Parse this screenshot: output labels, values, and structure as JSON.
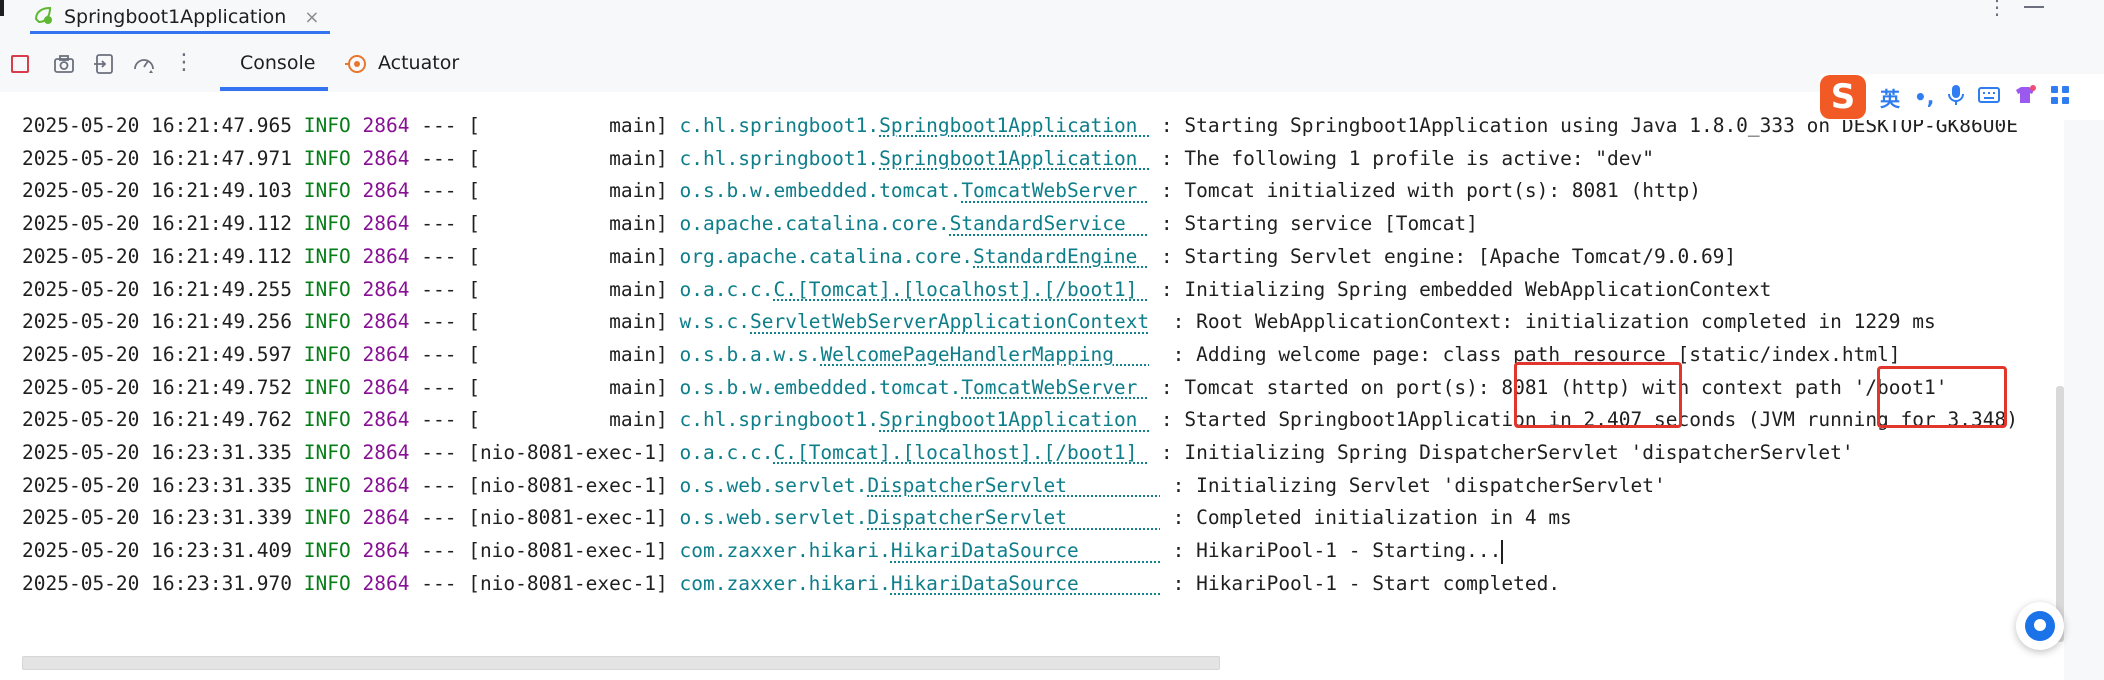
{
  "run_tab": {
    "title": "Springboot1Application",
    "close": "×"
  },
  "toolbar": {
    "tabs": [
      {
        "label": "Console",
        "active": true
      },
      {
        "label": "Actuator",
        "active": false
      }
    ],
    "more": "⋮"
  },
  "ime_toolbar": {
    "logo": "S",
    "lang": "英",
    "punct": "•,",
    "mic": "🎤",
    "keyboard": "⌨"
  },
  "colors": {
    "info": "#067d17",
    "pid": "#871094",
    "logger": "#0e7e8a",
    "accent": "#3574f0",
    "annotation": "#e0362b"
  },
  "console": {
    "lines": [
      {
        "ts": "2025-05-20 16:21:47.965",
        "level": "INFO",
        "pid": "2864",
        "sep": "---",
        "thread": "[           main]",
        "pkg": "c.hl.springboot1.",
        "cls": "Springboot1Application ",
        "msg": ": Starting Springboot1Application using Java 1.8.0_333 on DESKTOP-GK86U0E"
      },
      {
        "ts": "2025-05-20 16:21:47.971",
        "level": "INFO",
        "pid": "2864",
        "sep": "---",
        "thread": "[           main]",
        "pkg": "c.hl.springboot1.",
        "cls": "Springboot1Application ",
        "msg": ": The following 1 profile is active: \"dev\""
      },
      {
        "ts": "2025-05-20 16:21:49.103",
        "level": "INFO",
        "pid": "2864",
        "sep": "---",
        "thread": "[           main]",
        "pkg": "o.s.b.w.embedded.tomcat.",
        "cls": "TomcatWebServer ",
        "msg": ": Tomcat initialized with port(s): 8081 (http)"
      },
      {
        "ts": "2025-05-20 16:21:49.112",
        "level": "INFO",
        "pid": "2864",
        "sep": "---",
        "thread": "[           main]",
        "pkg": "o.apache.catalina.core.",
        "cls": "StandardService  ",
        "msg": ": Starting service [Tomcat]"
      },
      {
        "ts": "2025-05-20 16:21:49.112",
        "level": "INFO",
        "pid": "2864",
        "sep": "---",
        "thread": "[           main]",
        "pkg": "org.apache.catalina.core.",
        "cls": "StandardEngine ",
        "msg": ": Starting Servlet engine: [Apache Tomcat/9.0.69]"
      },
      {
        "ts": "2025-05-20 16:21:49.255",
        "level": "INFO",
        "pid": "2864",
        "sep": "---",
        "thread": "[           main]",
        "pkg": "o.a.c.c.",
        "cls": "C.[Tomcat].[localhost].[/boot1] ",
        "msg": ": Initializing Spring embedded WebApplicationContext"
      },
      {
        "ts": "2025-05-20 16:21:49.256",
        "level": "INFO",
        "pid": "2864",
        "sep": "---",
        "thread": "[           main]",
        "pkg": "w.s.c.",
        "cls": "ServletWebServerApplicationContext",
        "msg": " : Root WebApplicationContext: initialization completed in 1229 ms"
      },
      {
        "ts": "2025-05-20 16:21:49.597",
        "level": "INFO",
        "pid": "2864",
        "sep": "---",
        "thread": "[           main]",
        "pkg": "o.s.b.a.w.s.",
        "cls": "WelcomePageHandlerMapping   ",
        "msg": " : Adding welcome page: class path resource [static/index.html]"
      },
      {
        "ts": "2025-05-20 16:21:49.752",
        "level": "INFO",
        "pid": "2864",
        "sep": "---",
        "thread": "[           main]",
        "pkg": "o.s.b.w.embedded.tomcat.",
        "cls": "TomcatWebServer ",
        "msg": ": Tomcat started on port(s): 8081 (http) with context path '/boot1'"
      },
      {
        "ts": "2025-05-20 16:21:49.762",
        "level": "INFO",
        "pid": "2864",
        "sep": "---",
        "thread": "[           main]",
        "pkg": "c.hl.springboot1.",
        "cls": "Springboot1Application ",
        "msg": ": Started Springboot1Application in 2.407 seconds (JVM running for 3.348)"
      },
      {
        "ts": "2025-05-20 16:23:31.335",
        "level": "INFO",
        "pid": "2864",
        "sep": "---",
        "thread": "[nio-8081-exec-1]",
        "pkg": "o.a.c.c.",
        "cls": "C.[Tomcat].[localhost].[/boot1] ",
        "msg": ": Initializing Spring DispatcherServlet 'dispatcherServlet'"
      },
      {
        "ts": "2025-05-20 16:23:31.335",
        "level": "INFO",
        "pid": "2864",
        "sep": "---",
        "thread": "[nio-8081-exec-1]",
        "pkg": "o.s.web.servlet.",
        "cls": "DispatcherServlet        ",
        "msg": ": Initializing Servlet 'dispatcherServlet'"
      },
      {
        "ts": "2025-05-20 16:23:31.339",
        "level": "INFO",
        "pid": "2864",
        "sep": "---",
        "thread": "[nio-8081-exec-1]",
        "pkg": "o.s.web.servlet.",
        "cls": "DispatcherServlet        ",
        "msg": ": Completed initialization in 4 ms"
      },
      {
        "ts": "2025-05-20 16:23:31.409",
        "level": "INFO",
        "pid": "2864",
        "sep": "---",
        "thread": "[nio-8081-exec-1]",
        "pkg": "com.zaxxer.hikari.",
        "cls": "HikariDataSource       ",
        "msg": ": HikariPool-1 - Starting..."
      },
      {
        "ts": "2025-05-20 16:23:31.970",
        "level": "INFO",
        "pid": "2864",
        "sep": "---",
        "thread": "[nio-8081-exec-1]",
        "pkg": "com.zaxxer.hikari.",
        "cls": "HikariDataSource       ",
        "msg": ": HikariPool-1 - Start completed."
      }
    ]
  }
}
